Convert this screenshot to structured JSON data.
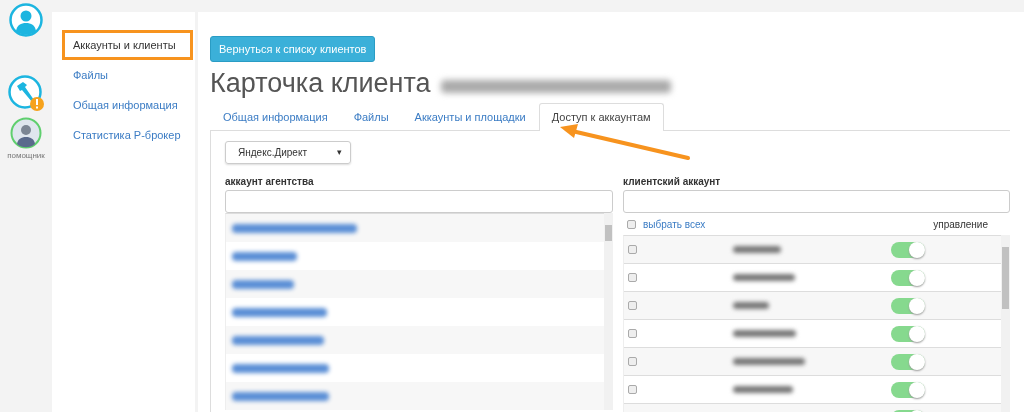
{
  "rail": {
    "assistant_label": "помощник",
    "alert": true
  },
  "sidebar": {
    "items": [
      {
        "label": "Аккаунты и клиенты",
        "selected": true,
        "highlighted": true
      },
      {
        "label": "Файлы",
        "selected": false,
        "highlighted": false
      },
      {
        "label": "Общая информация",
        "selected": false,
        "highlighted": false
      },
      {
        "label": "Статистика Р-брокер",
        "selected": false,
        "highlighted": false
      }
    ]
  },
  "back_button": "Вернуться к списку клиентов",
  "title": {
    "text": "Карточка клиента",
    "email_blurred": true
  },
  "tabs": [
    {
      "label": "Общая информация",
      "selected": false
    },
    {
      "label": "Файлы",
      "selected": false
    },
    {
      "label": "Аккаунты и площадки",
      "selected": false
    },
    {
      "label": "Доступ к аккаунтам",
      "selected": true
    }
  ],
  "system_select": {
    "value": "Яндекс.Директ",
    "caret": "▾"
  },
  "agency": {
    "label": "аккаунт агентства",
    "rows": [
      {
        "kind": "blurred"
      },
      {
        "kind": "blurred"
      },
      {
        "kind": "blurred"
      },
      {
        "kind": "blurred"
      },
      {
        "kind": "blurred"
      },
      {
        "kind": "blurred"
      },
      {
        "kind": "blurred"
      }
    ]
  },
  "client": {
    "label": "клиентский аккаунт",
    "select_all": {
      "label": "выбрать всех",
      "checked": false
    },
    "management_header": "управление",
    "rows": [
      {
        "kind": "blurred",
        "checked": false,
        "management": true
      },
      {
        "kind": "blurred",
        "checked": false,
        "management": true
      },
      {
        "kind": "blurred",
        "checked": false,
        "management": true
      },
      {
        "kind": "blurred",
        "checked": false,
        "management": true
      },
      {
        "kind": "blurred",
        "checked": false,
        "management": true
      },
      {
        "kind": "blurred",
        "checked": false,
        "management": true
      },
      {
        "kind": "cut",
        "management": true
      }
    ]
  },
  "annotation": {
    "arrow": true
  }
}
